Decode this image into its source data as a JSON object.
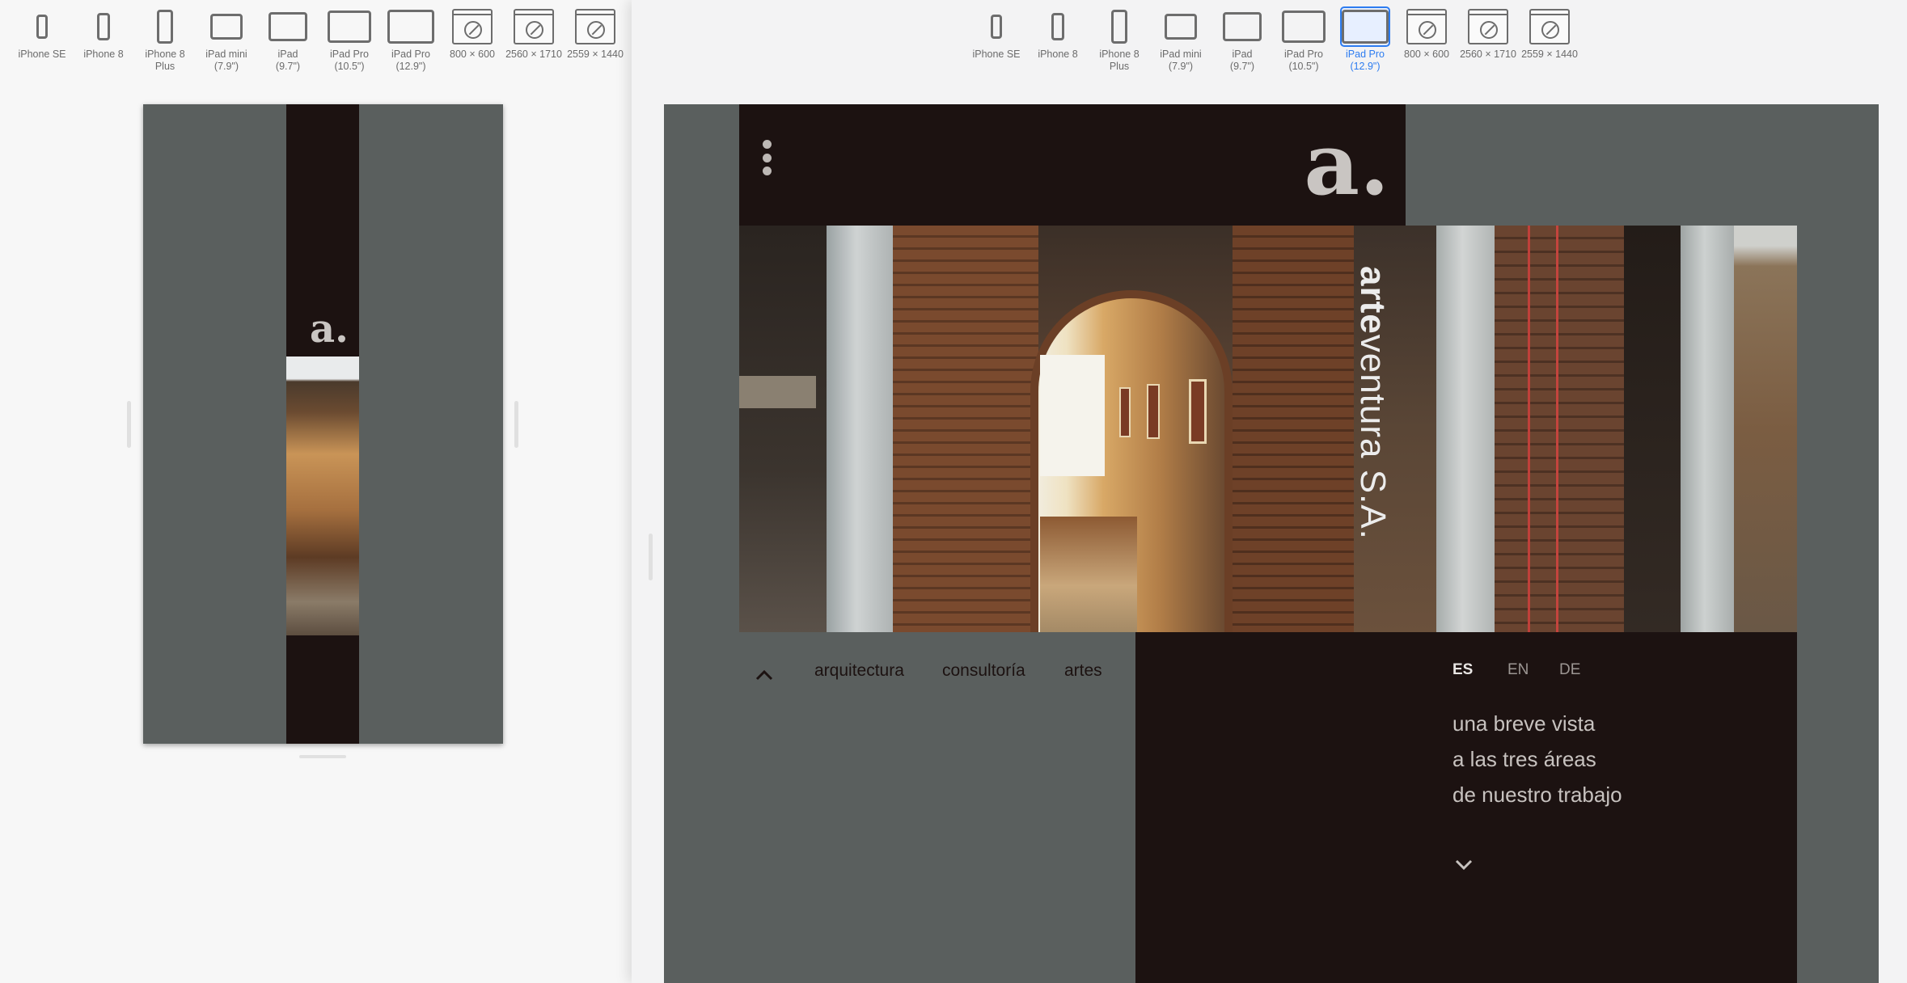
{
  "devices": [
    {
      "label": "iPhone SE",
      "icon": "iphone-icon"
    },
    {
      "label": "iPhone 8",
      "icon": "iphone-icon"
    },
    {
      "label": "iPhone 8\nPlus",
      "icon": "iphone-icon"
    },
    {
      "label": "iPad mini\n(7.9\")",
      "icon": "ipad-icon"
    },
    {
      "label": "iPad\n(9.7\")",
      "icon": "ipad-icon"
    },
    {
      "label": "iPad Pro\n(10.5\")",
      "icon": "ipad-icon"
    },
    {
      "label": "iPad Pro\n(12.9\")",
      "icon": "ipad-icon"
    },
    {
      "label": "800 × 600",
      "icon": "browser-window-icon"
    },
    {
      "label": "2560 × 1710",
      "icon": "browser-window-icon"
    },
    {
      "label": "2559 × 1440",
      "icon": "browser-window-icon"
    }
  ],
  "right_selected_index": 6,
  "site": {
    "logo_text": "a.",
    "vertical_title_bold": "arte",
    "vertical_title_rest": "ventura S.A.",
    "nav": [
      "arquitectura",
      "consultoría",
      "artes"
    ],
    "languages": [
      "ES",
      "EN",
      "DE"
    ],
    "active_language": "ES",
    "tagline": [
      "una breve vista",
      "a las tres áreas",
      "de nuestro trabajo"
    ]
  },
  "colors": {
    "dark_brown": "#1c1211",
    "slate_gray": "#5a5f5e",
    "selected_blue": "#2d7cf0"
  }
}
